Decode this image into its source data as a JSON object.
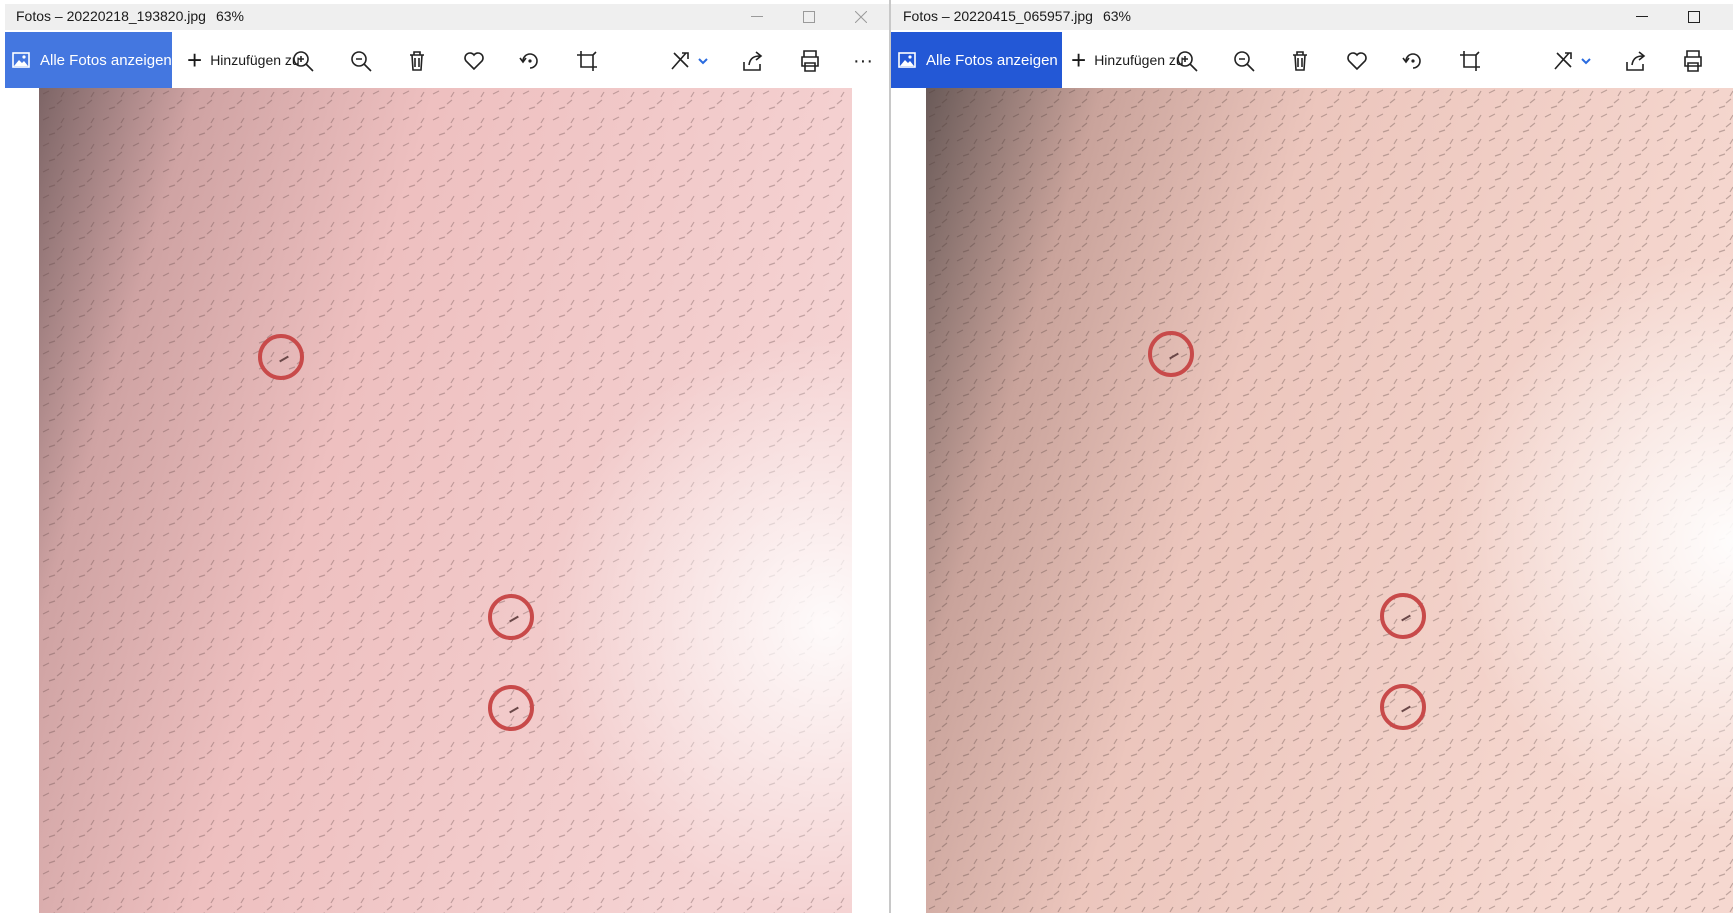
{
  "windows": [
    {
      "app": "Fotos",
      "separator": "–",
      "filename": "20220218_193820.jpg",
      "zoom": "63%",
      "title": "Fotos – 20220218_193820.jpg",
      "all_photos_label": "Alle Fotos anzeigen",
      "add_label": "Hinzufügen zu",
      "more_label": "···"
    },
    {
      "app": "Fotos",
      "separator": "–",
      "filename": "20220415_065957.jpg",
      "zoom": "63%",
      "title": "Fotos – 20220415_065957.jpg",
      "all_photos_label": "Alle Fotos anzeigen",
      "add_label": "Hinzufügen zu"
    }
  ],
  "icons": [
    "zoom-in-icon",
    "zoom-out-icon",
    "delete-icon",
    "favorite-icon",
    "rotate-icon",
    "crop-icon",
    "edit-icon",
    "chevron-down-icon",
    "share-icon",
    "print-icon",
    "more-icon"
  ],
  "colors": {
    "accent_left": "#4477e0",
    "accent_right": "#2358d6",
    "marker": "#c84a4a",
    "skin": "#efc3c2"
  }
}
